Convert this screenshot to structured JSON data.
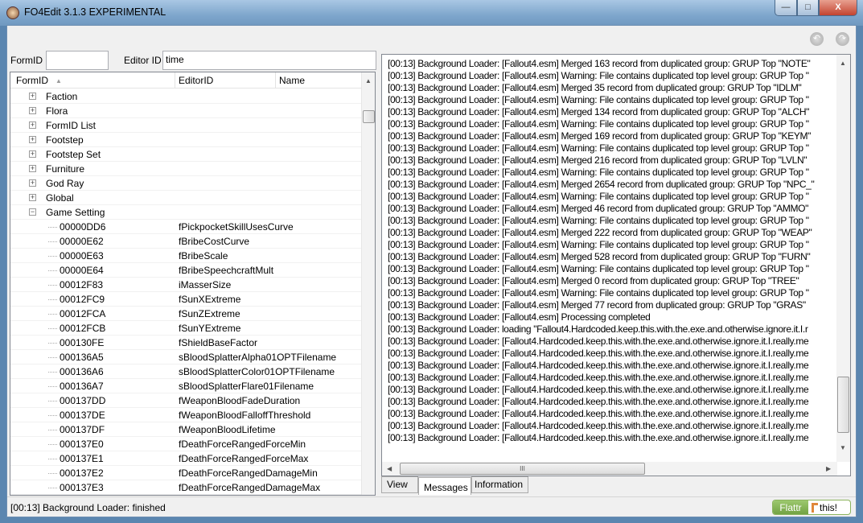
{
  "window": {
    "title": "FO4Edit 3.1.3 EXPERIMENTAL",
    "minimize": "—",
    "maximize": "□",
    "close": "X"
  },
  "nav": {
    "back_icon": "back-arrow-icon",
    "forward_icon": "forward-arrow-icon"
  },
  "filter": {
    "formid_label": "FormID",
    "formid_value": "",
    "editorid_label": "Editor ID",
    "editorid_value": "time"
  },
  "tree": {
    "columns": [
      "FormID",
      "EditorID",
      "Name"
    ],
    "sort_indicator": "▲",
    "groups": [
      {
        "name": "Faction",
        "expanded": false
      },
      {
        "name": "Flora",
        "expanded": false
      },
      {
        "name": "FormID List",
        "expanded": false
      },
      {
        "name": "Footstep",
        "expanded": false
      },
      {
        "name": "Footstep Set",
        "expanded": false
      },
      {
        "name": "Furniture",
        "expanded": false
      },
      {
        "name": "God Ray",
        "expanded": false
      },
      {
        "name": "Global",
        "expanded": false
      },
      {
        "name": "Game Setting",
        "expanded": true
      }
    ],
    "records": [
      [
        "00000DD6",
        "fPickpocketSkillUsesCurve"
      ],
      [
        "00000E62",
        "fBribeCostCurve"
      ],
      [
        "00000E63",
        "fBribeScale"
      ],
      [
        "00000E64",
        "fBribeSpeechcraftMult"
      ],
      [
        "00012F83",
        "iMasserSize"
      ],
      [
        "00012FC9",
        "fSunXExtreme"
      ],
      [
        "00012FCA",
        "fSunZExtreme"
      ],
      [
        "00012FCB",
        "fSunYExtreme"
      ],
      [
        "000130FE",
        "fShieldBaseFactor"
      ],
      [
        "000136A5",
        "sBloodSplatterAlpha01OPTFilename"
      ],
      [
        "000136A6",
        "sBloodSplatterColor01OPTFilename"
      ],
      [
        "000136A7",
        "sBloodSplatterFlare01Filename"
      ],
      [
        "000137DD",
        "fWeaponBloodFadeDuration"
      ],
      [
        "000137DE",
        "fWeaponBloodFalloffThreshold"
      ],
      [
        "000137DF",
        "fWeaponBloodLifetime"
      ],
      [
        "000137E0",
        "fDeathForceRangedForceMin"
      ],
      [
        "000137E1",
        "fDeathForceRangedForceMax"
      ],
      [
        "000137E2",
        "fDeathForceRangedDamageMin"
      ],
      [
        "000137E3",
        "fDeathForceRangedDamageMax"
      ]
    ]
  },
  "log": [
    "[00:13] Background Loader: [Fallout4.esm] Merged 163 record from duplicated group: GRUP Top \"NOTE\"",
    "[00:13] Background Loader: [Fallout4.esm] Warning: File contains duplicated top level group: GRUP Top \"",
    "[00:13] Background Loader: [Fallout4.esm] Merged 35 record from duplicated group: GRUP Top \"IDLM\"",
    "[00:13] Background Loader: [Fallout4.esm] Warning: File contains duplicated top level group: GRUP Top \"",
    "[00:13] Background Loader: [Fallout4.esm] Merged 134 record from duplicated group: GRUP Top \"ALCH\"",
    "[00:13] Background Loader: [Fallout4.esm] Warning: File contains duplicated top level group: GRUP Top \"",
    "[00:13] Background Loader: [Fallout4.esm] Merged 169 record from duplicated group: GRUP Top \"KEYM\"",
    "[00:13] Background Loader: [Fallout4.esm] Warning: File contains duplicated top level group: GRUP Top \"",
    "[00:13] Background Loader: [Fallout4.esm] Merged 216 record from duplicated group: GRUP Top \"LVLN\"",
    "[00:13] Background Loader: [Fallout4.esm] Warning: File contains duplicated top level group: GRUP Top \"",
    "[00:13] Background Loader: [Fallout4.esm] Merged 2654 record from duplicated group: GRUP Top \"NPC_\"",
    "[00:13] Background Loader: [Fallout4.esm] Warning: File contains duplicated top level group: GRUP Top \"",
    "[00:13] Background Loader: [Fallout4.esm] Merged 46 record from duplicated group: GRUP Top \"AMMO\"",
    "[00:13] Background Loader: [Fallout4.esm] Warning: File contains duplicated top level group: GRUP Top \"",
    "[00:13] Background Loader: [Fallout4.esm] Merged 222 record from duplicated group: GRUP Top \"WEAP\"",
    "[00:13] Background Loader: [Fallout4.esm] Warning: File contains duplicated top level group: GRUP Top \"",
    "[00:13] Background Loader: [Fallout4.esm] Merged 528 record from duplicated group: GRUP Top \"FURN\"",
    "[00:13] Background Loader: [Fallout4.esm] Warning: File contains duplicated top level group: GRUP Top \"",
    "[00:13] Background Loader: [Fallout4.esm] Merged 0 record from duplicated group: GRUP Top \"TREE\"",
    "[00:13] Background Loader: [Fallout4.esm] Warning: File contains duplicated top level group: GRUP Top \"",
    "[00:13] Background Loader: [Fallout4.esm] Merged 77 record from duplicated group: GRUP Top \"GRAS\"",
    "[00:13] Background Loader: [Fallout4.esm] Processing completed",
    "[00:13] Background Loader: loading \"Fallout4.Hardcoded.keep.this.with.the.exe.and.otherwise.ignore.it.I.r",
    "[00:13] Background Loader: [Fallout4.Hardcoded.keep.this.with.the.exe.and.otherwise.ignore.it.I.really.me",
    "[00:13] Background Loader: [Fallout4.Hardcoded.keep.this.with.the.exe.and.otherwise.ignore.it.I.really.me",
    "[00:13] Background Loader: [Fallout4.Hardcoded.keep.this.with.the.exe.and.otherwise.ignore.it.I.really.me",
    "[00:13] Background Loader: [Fallout4.Hardcoded.keep.this.with.the.exe.and.otherwise.ignore.it.I.really.me",
    "[00:13] Background Loader: [Fallout4.Hardcoded.keep.this.with.the.exe.and.otherwise.ignore.it.I.really.me",
    "[00:13] Background Loader: [Fallout4.Hardcoded.keep.this.with.the.exe.and.otherwise.ignore.it.I.really.me",
    "[00:13] Background Loader: [Fallout4.Hardcoded.keep.this.with.the.exe.and.otherwise.ignore.it.I.really.me",
    "[00:13] Background Loader: [Fallout4.Hardcoded.keep.this.with.the.exe.and.otherwise.ignore.it.I.really.me",
    "[00:13] Background Loader: [Fallout4.Hardcoded.keep.this.with.the.exe.and.otherwise.ignore.it.I.really.me"
  ],
  "tabs": [
    {
      "label": "View",
      "active": false
    },
    {
      "label": "Messages",
      "active": true
    },
    {
      "label": "Information",
      "active": false
    }
  ],
  "status": {
    "text": "[00:13] Background Loader: finished",
    "flattr_left": "Flattr",
    "flattr_right": "this!"
  },
  "scroll_glyphs": {
    "up": "▲",
    "down": "▼",
    "left": "◀",
    "right": "▶",
    "grip": "III"
  }
}
